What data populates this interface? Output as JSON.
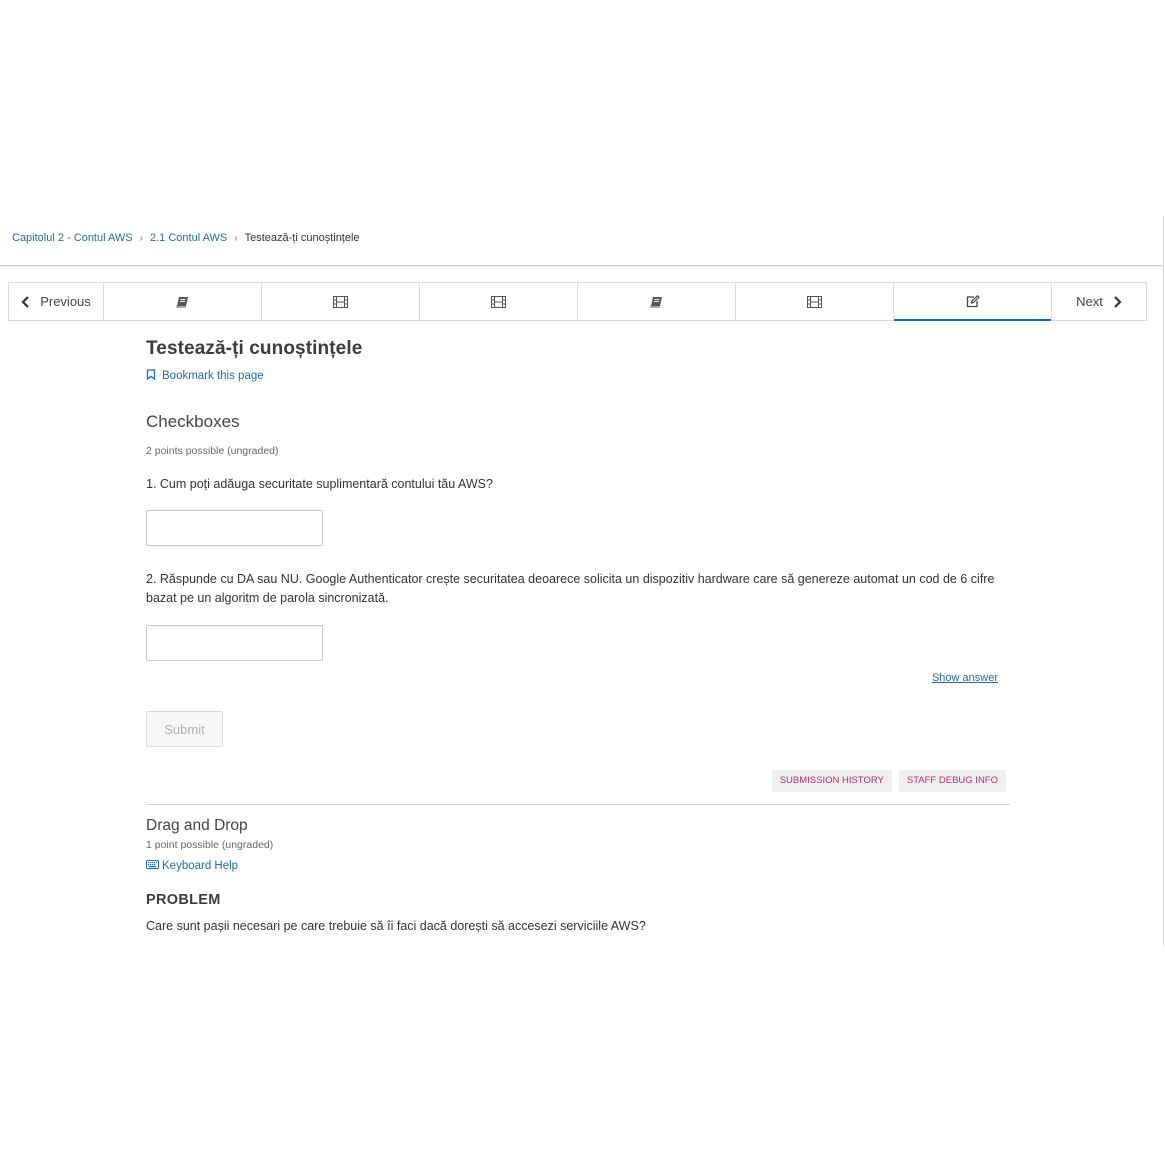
{
  "breadcrumb": {
    "items": [
      {
        "label": "Capitolul 2 - Contul AWS"
      },
      {
        "label": "2.1 Contul AWS"
      }
    ],
    "separator": "›",
    "current": "Testează-ți cunoștințele"
  },
  "sequence_nav": {
    "previous_label": "Previous",
    "next_label": "Next",
    "tabs": [
      {
        "icon": "book-icon",
        "active": false
      },
      {
        "icon": "film-icon",
        "active": false
      },
      {
        "icon": "film-icon",
        "active": false
      },
      {
        "icon": "book-icon",
        "active": false
      },
      {
        "icon": "film-icon",
        "active": false
      },
      {
        "icon": "edit-icon",
        "active": true
      }
    ],
    "active_color": "#0e6fb8"
  },
  "unit": {
    "title": "Testează-ți cunoștințele",
    "bookmark_label": "Bookmark this page"
  },
  "problem1": {
    "title": "Checkboxes",
    "points": "2 points possible (ungraded)",
    "question1": "1. Cum poți adăuga securitate suplimentară contului tău AWS?",
    "answer1_value": "",
    "question2": "2. Răspunde cu DA sau NU. Google Authenticator crește securitatea deoarece solicita un dispozitiv hardware care să genereze automat un cod de 6 cifre bazat pe un algoritm de parola sincronizată.",
    "answer2_value": "",
    "show_answer_label": "Show answer",
    "submit_label": "Submit",
    "submission_history_label": "SUBMISSION HISTORY",
    "staff_debug_label": "STAFF DEBUG INFO"
  },
  "problem2": {
    "title": "Drag and Drop",
    "points": "1 point possible (ungraded)",
    "keyboard_help_label": "Keyboard Help",
    "section_label": "PROBLEM",
    "question": "Care sunt pașii necesari pe care trebuie să îi faci dacă dorești să accesezi serviciile AWS?"
  },
  "colors": {
    "link": "#1f6fa5",
    "staff_text": "#b0336b",
    "active_tab": "#0e6fb8"
  }
}
